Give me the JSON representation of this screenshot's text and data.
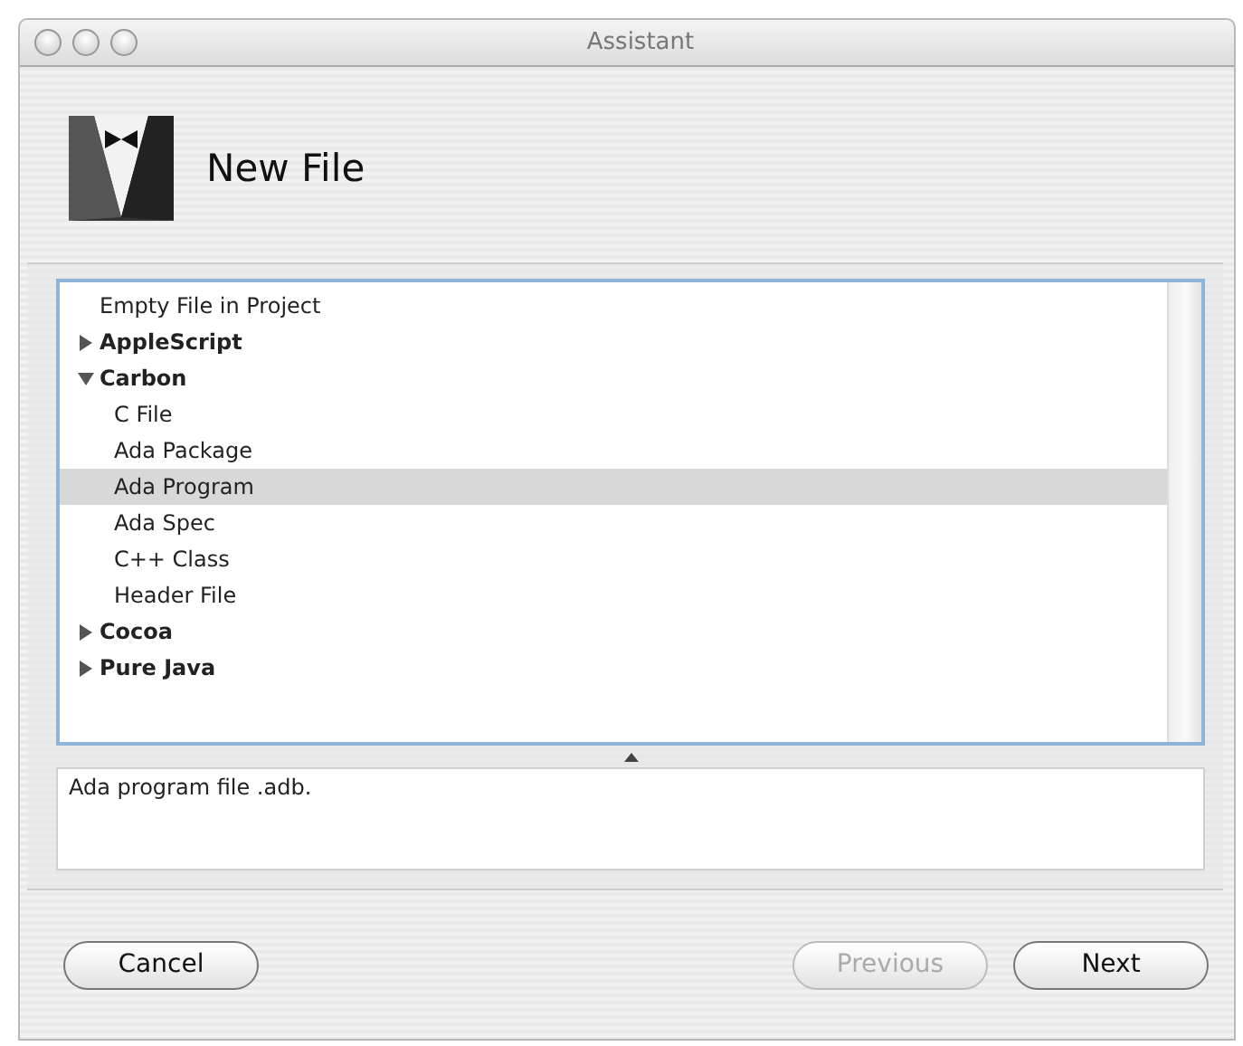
{
  "window": {
    "title": "Assistant"
  },
  "header": {
    "title": "New File"
  },
  "tree": [
    {
      "kind": "item",
      "label": "Empty File in Project",
      "selected": false
    },
    {
      "kind": "group",
      "label": "AppleScript",
      "expanded": false,
      "selected": false
    },
    {
      "kind": "group",
      "label": "Carbon",
      "expanded": true,
      "selected": false,
      "children": [
        {
          "kind": "item",
          "label": "C File",
          "selected": false
        },
        {
          "kind": "item",
          "label": "Ada Package",
          "selected": false
        },
        {
          "kind": "item",
          "label": "Ada Program",
          "selected": true
        },
        {
          "kind": "item",
          "label": "Ada Spec",
          "selected": false
        },
        {
          "kind": "item",
          "label": "C++ Class",
          "selected": false
        },
        {
          "kind": "item",
          "label": "Header File",
          "selected": false
        }
      ]
    },
    {
      "kind": "group",
      "label": "Cocoa",
      "expanded": false,
      "selected": false
    },
    {
      "kind": "group",
      "label": "Pure Java",
      "expanded": false,
      "selected": false
    }
  ],
  "description": "Ada program file .adb.",
  "buttons": [
    {
      "label": "Cancel",
      "disabled": false
    },
    {
      "label": "Previous",
      "disabled": true
    },
    {
      "label": "Next",
      "disabled": false
    }
  ]
}
